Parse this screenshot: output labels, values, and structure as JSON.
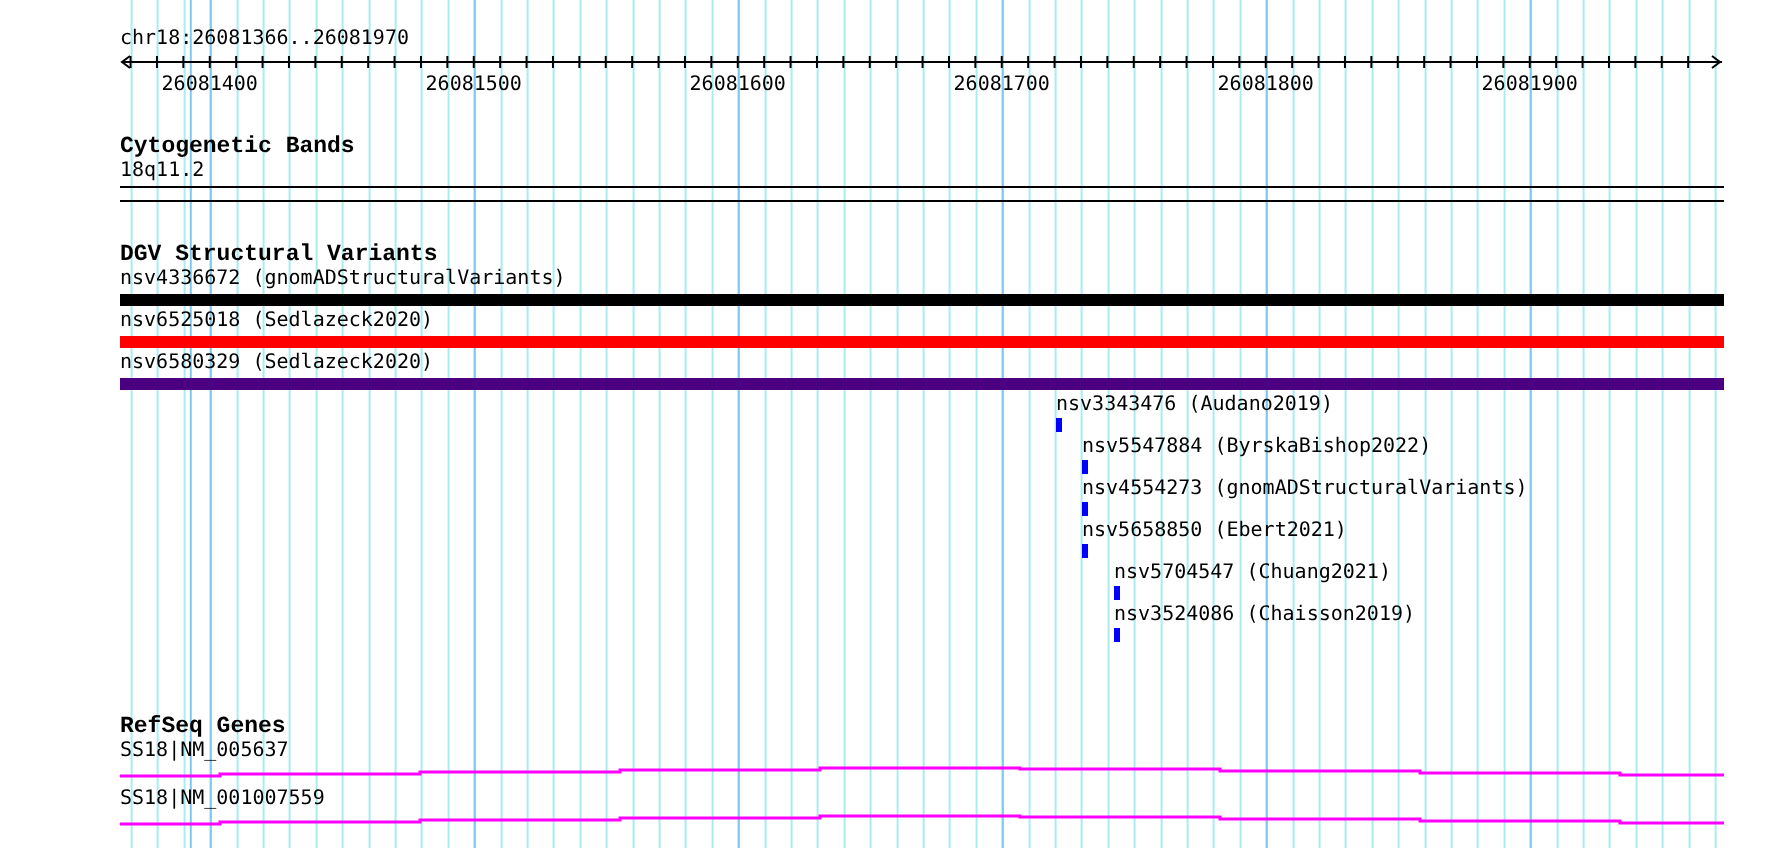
{
  "ruler": {
    "location": "chr18:26081366..26081970",
    "tick_labels": [
      "26081400",
      "26081500",
      "26081600",
      "26081700",
      "26081800",
      "26081900"
    ]
  },
  "cytogenetic_bands": {
    "title": "Cytogenetic Bands",
    "bands": [
      {
        "label": "18q11.2"
      }
    ]
  },
  "dgv_structural_variants": {
    "title": "DGV Structural Variants",
    "items": [
      {
        "label": "nsv4336672 (gnomADStructuralVariants)",
        "kind": "bar",
        "color": "#000000"
      },
      {
        "label": "nsv6525018 (Sedlazeck2020)",
        "kind": "bar",
        "color": "#ff0000"
      },
      {
        "label": "nsv6580329 (Sedlazeck2020)",
        "kind": "bar",
        "color": "#4b0082"
      },
      {
        "label": "nsv3343476 (Audano2019)",
        "kind": "point",
        "color": "#0000ff"
      },
      {
        "label": "nsv5547884 (ByrskaBishop2022)",
        "kind": "point",
        "color": "#0000ff"
      },
      {
        "label": "nsv4554273 (gnomADStructuralVariants)",
        "kind": "point",
        "color": "#0000ff"
      },
      {
        "label": "nsv5658850 (Ebert2021)",
        "kind": "point",
        "color": "#0000ff"
      },
      {
        "label": "nsv5704547 (Chuang2021)",
        "kind": "point",
        "color": "#0000ff"
      },
      {
        "label": "nsv3524086 (Chaisson2019)",
        "kind": "point",
        "color": "#0000ff"
      }
    ]
  },
  "refseq_genes": {
    "title": "RefSeq Genes",
    "genes": [
      {
        "label": "SS18|NM_005637"
      },
      {
        "label": "SS18|NM_001007559"
      }
    ]
  }
}
